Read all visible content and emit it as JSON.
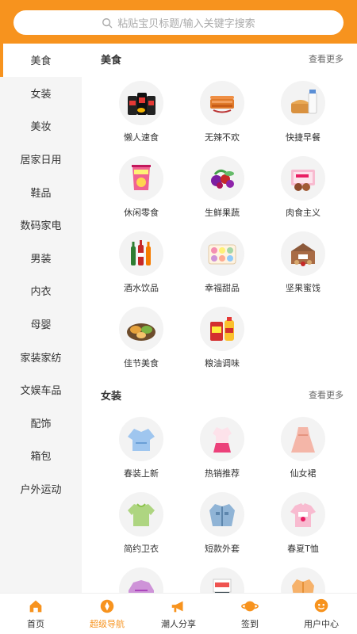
{
  "search": {
    "placeholder": "粘贴宝贝标题/输入关键字搜索"
  },
  "sidebar": {
    "items": [
      {
        "label": "美食",
        "active": true
      },
      {
        "label": "女装",
        "active": false
      },
      {
        "label": "美妆",
        "active": false
      },
      {
        "label": "居家日用",
        "active": false
      },
      {
        "label": "鞋品",
        "active": false
      },
      {
        "label": "数码家电",
        "active": false
      },
      {
        "label": "男装",
        "active": false
      },
      {
        "label": "内衣",
        "active": false
      },
      {
        "label": "母婴",
        "active": false
      },
      {
        "label": "家装家纺",
        "active": false
      },
      {
        "label": "文娱车品",
        "active": false
      },
      {
        "label": "配饰",
        "active": false
      },
      {
        "label": "箱包",
        "active": false
      },
      {
        "label": "户外运动",
        "active": false
      }
    ]
  },
  "sections": [
    {
      "title": "美食",
      "more": "查看更多",
      "items": [
        {
          "label": "懒人速食",
          "icon": "instant-noodles-icon"
        },
        {
          "label": "无辣不欢",
          "icon": "spicy-strips-icon"
        },
        {
          "label": "快捷早餐",
          "icon": "bread-milk-icon"
        },
        {
          "label": "休闲零食",
          "icon": "chips-bag-icon"
        },
        {
          "label": "生鲜果蔬",
          "icon": "fruits-icon"
        },
        {
          "label": "肉食主义",
          "icon": "meat-box-icon"
        },
        {
          "label": "酒水饮品",
          "icon": "drink-bottles-icon"
        },
        {
          "label": "幸福甜品",
          "icon": "macaron-icon"
        },
        {
          "label": "坚果蜜饯",
          "icon": "nuts-box-icon"
        },
        {
          "label": "佳节美食",
          "icon": "mooncake-icon"
        },
        {
          "label": "粮油调味",
          "icon": "rice-oil-icon"
        }
      ]
    },
    {
      "title": "女装",
      "more": "查看更多",
      "items": [
        {
          "label": "春装上新",
          "icon": "blouse-icon"
        },
        {
          "label": "热销推荐",
          "icon": "outfit-icon"
        },
        {
          "label": "仙女裙",
          "icon": "dress-icon"
        },
        {
          "label": "简约卫衣",
          "icon": "sweatshirt-icon"
        },
        {
          "label": "短款外套",
          "icon": "denim-jacket-icon"
        },
        {
          "label": "春夏T恤",
          "icon": "tshirt-icon"
        },
        {
          "label": "",
          "icon": "sweater-icon"
        },
        {
          "label": "",
          "icon": "set-outfit-icon"
        },
        {
          "label": "",
          "icon": "coat-icon"
        }
      ]
    }
  ],
  "tabs": [
    {
      "label": "首页",
      "icon": "home-icon",
      "active": false
    },
    {
      "label": "超级导航",
      "icon": "compass-icon",
      "active": true
    },
    {
      "label": "潮人分享",
      "icon": "megaphone-icon",
      "active": false
    },
    {
      "label": "签到",
      "icon": "planet-icon",
      "active": false
    },
    {
      "label": "用户中心",
      "icon": "user-icon",
      "active": false
    }
  ],
  "colors": {
    "accent": "#f7931e",
    "sidebar_bg": "#f5f5f5",
    "thumb_bg": "#f3f3f3"
  }
}
